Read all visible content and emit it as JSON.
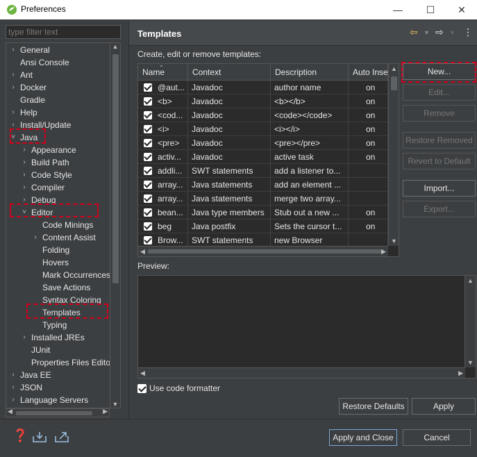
{
  "window": {
    "title": "Preferences",
    "minimize": "—",
    "maximize": "☐",
    "close": "✕"
  },
  "filter": {
    "placeholder": "type filter text"
  },
  "tree": {
    "items": [
      {
        "label": "General",
        "chev": "›"
      },
      {
        "label": "Ansi Console",
        "chev": ""
      },
      {
        "label": "Ant",
        "chev": "›"
      },
      {
        "label": "Docker",
        "chev": "›"
      },
      {
        "label": "Gradle",
        "chev": ""
      },
      {
        "label": "Help",
        "chev": "›"
      },
      {
        "label": "Install/Update",
        "chev": "›"
      },
      {
        "label": "Java",
        "chev": "˅"
      },
      {
        "label": "Appearance",
        "chev": "›"
      },
      {
        "label": "Build Path",
        "chev": "›"
      },
      {
        "label": "Code Style",
        "chev": "›"
      },
      {
        "label": "Compiler",
        "chev": "›"
      },
      {
        "label": "Debug",
        "chev": "›"
      },
      {
        "label": "Editor",
        "chev": "˅"
      },
      {
        "label": "Code Minings",
        "chev": ""
      },
      {
        "label": "Content Assist",
        "chev": "›"
      },
      {
        "label": "Folding",
        "chev": ""
      },
      {
        "label": "Hovers",
        "chev": ""
      },
      {
        "label": "Mark Occurrences",
        "chev": ""
      },
      {
        "label": "Save Actions",
        "chev": ""
      },
      {
        "label": "Syntax Coloring",
        "chev": ""
      },
      {
        "label": "Templates",
        "chev": ""
      },
      {
        "label": "Typing",
        "chev": ""
      },
      {
        "label": "Installed JREs",
        "chev": "›"
      },
      {
        "label": "JUnit",
        "chev": ""
      },
      {
        "label": "Properties Files Edito",
        "chev": ""
      },
      {
        "label": "Java EE",
        "chev": "›"
      },
      {
        "label": "JSON",
        "chev": "›"
      },
      {
        "label": "Language Servers",
        "chev": "›"
      }
    ]
  },
  "page": {
    "title": "Templates",
    "description": "Create, edit or remove templates:",
    "back_icon": "⇦",
    "forward_icon": "⇨",
    "menu_icon": "⋮"
  },
  "table": {
    "headers": [
      "Name",
      "Context",
      "Description",
      "Auto Inse"
    ],
    "rows": [
      {
        "name": "@aut...",
        "context": "Javadoc",
        "description": "author name",
        "auto": "on"
      },
      {
        "name": "<b>",
        "context": "Javadoc",
        "description": "<b></b>",
        "auto": "on"
      },
      {
        "name": "<cod...",
        "context": "Javadoc",
        "description": "<code></code>",
        "auto": "on"
      },
      {
        "name": "<i>",
        "context": "Javadoc",
        "description": "<i></i>",
        "auto": "on"
      },
      {
        "name": "<pre>",
        "context": "Javadoc",
        "description": "<pre></pre>",
        "auto": "on"
      },
      {
        "name": "activ...",
        "context": "Javadoc",
        "description": "active task",
        "auto": "on"
      },
      {
        "name": "addli...",
        "context": "SWT statements",
        "description": "add a listener to...",
        "auto": ""
      },
      {
        "name": "array...",
        "context": "Java statements",
        "description": "add an element ...",
        "auto": ""
      },
      {
        "name": "array...",
        "context": "Java statements",
        "description": "merge two array...",
        "auto": ""
      },
      {
        "name": "bean...",
        "context": "Java type members",
        "description": "Stub out a new ...",
        "auto": "on"
      },
      {
        "name": "beg",
        "context": "Java postfix",
        "description": "Sets the cursor t...",
        "auto": "on"
      },
      {
        "name": "Brow...",
        "context": "SWT statements",
        "description": "new Browser",
        "auto": ""
      }
    ]
  },
  "buttons": {
    "new": "New...",
    "edit": "Edit...",
    "remove": "Remove",
    "restore_removed": "Restore Removed",
    "revert_default": "Revert to Default",
    "import": "Import...",
    "export": "Export...",
    "restore_defaults": "Restore Defaults",
    "apply": "Apply",
    "apply_close": "Apply and Close",
    "cancel": "Cancel"
  },
  "preview": {
    "label": "Preview:"
  },
  "use_code_formatter": "Use code formatter",
  "colors": {
    "background": "#3c3f41",
    "annotation": "#d6001c",
    "accent_icon": "#e8c25b"
  }
}
